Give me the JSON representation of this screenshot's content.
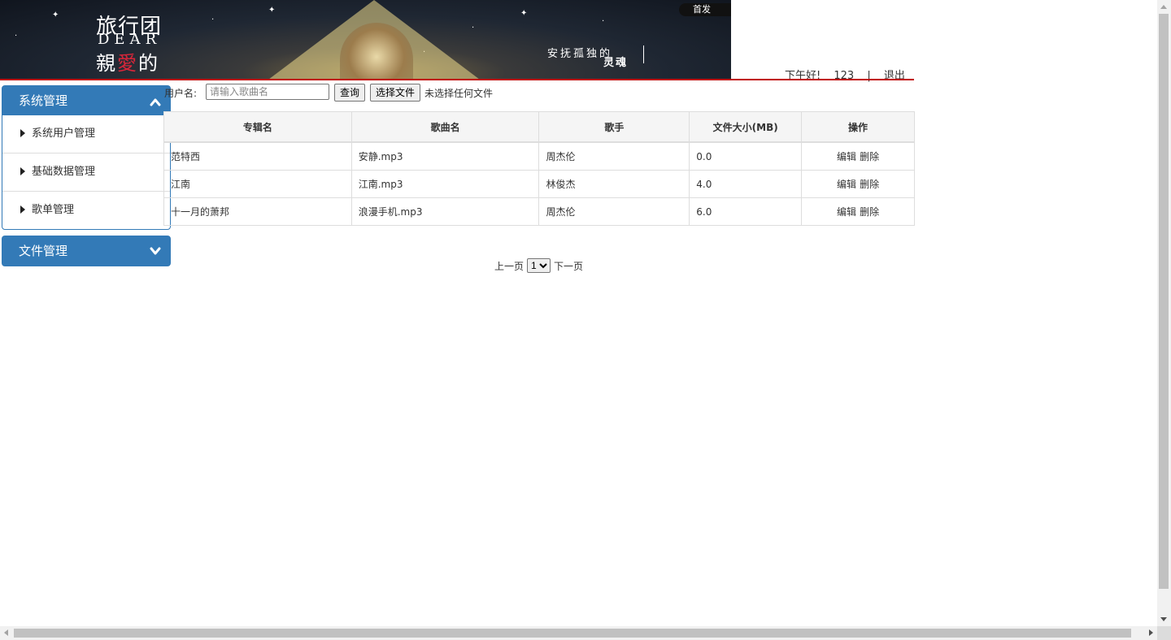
{
  "banner": {
    "title_line1": "旅行团",
    "title_line2": "DEAR",
    "title_line3_a": "親",
    "title_line3_b": "愛",
    "title_line3_c": "的",
    "slogan_line1": "安抚孤独的",
    "slogan_line2": "灵魂",
    "badge": "首发"
  },
  "header": {
    "greeting": "下午好!",
    "username": "123",
    "separator": "|",
    "logout": "退出"
  },
  "sidebar": {
    "panels": [
      {
        "title": "系统管理",
        "expanded": true,
        "items": [
          {
            "label": "系统用户管理"
          },
          {
            "label": "基础数据管理"
          },
          {
            "label": "歌单管理"
          }
        ]
      },
      {
        "title": "文件管理",
        "expanded": false,
        "items": []
      }
    ]
  },
  "toolbar": {
    "search_label": "用户名:",
    "search_placeholder": "请输入歌曲名",
    "search_value": "",
    "query_button": "查询",
    "choose_file_button": "选择文件",
    "no_file_text": "未选择任何文件"
  },
  "table": {
    "headers": [
      "专辑名",
      "歌曲名",
      "歌手",
      "文件大小(MB)",
      "操作"
    ],
    "rows": [
      {
        "album": "范特西",
        "song": "安静.mp3",
        "singer": "周杰伦",
        "size": "0.0",
        "edit": "编辑",
        "delete": "删除"
      },
      {
        "album": "江南",
        "song": "江南.mp3",
        "singer": "林俊杰",
        "size": "4.0",
        "edit": "编辑",
        "delete": "删除"
      },
      {
        "album": "十一月的萧邦",
        "song": "浪漫手机.mp3",
        "singer": "周杰伦",
        "size": "6.0",
        "edit": "编辑",
        "delete": "删除"
      }
    ]
  },
  "pager": {
    "prev": "上一页",
    "page_options": [
      "1"
    ],
    "selected_page": "1",
    "next": "下一页"
  },
  "colors": {
    "accent": "#337ab7",
    "divider_red": "#c00000",
    "banner_dark": "#1f2733"
  },
  "icons": {
    "panel_expanded": "chevron-up-icon",
    "panel_collapsed": "chevron-down-icon",
    "menu_item": "caret-right-icon"
  }
}
